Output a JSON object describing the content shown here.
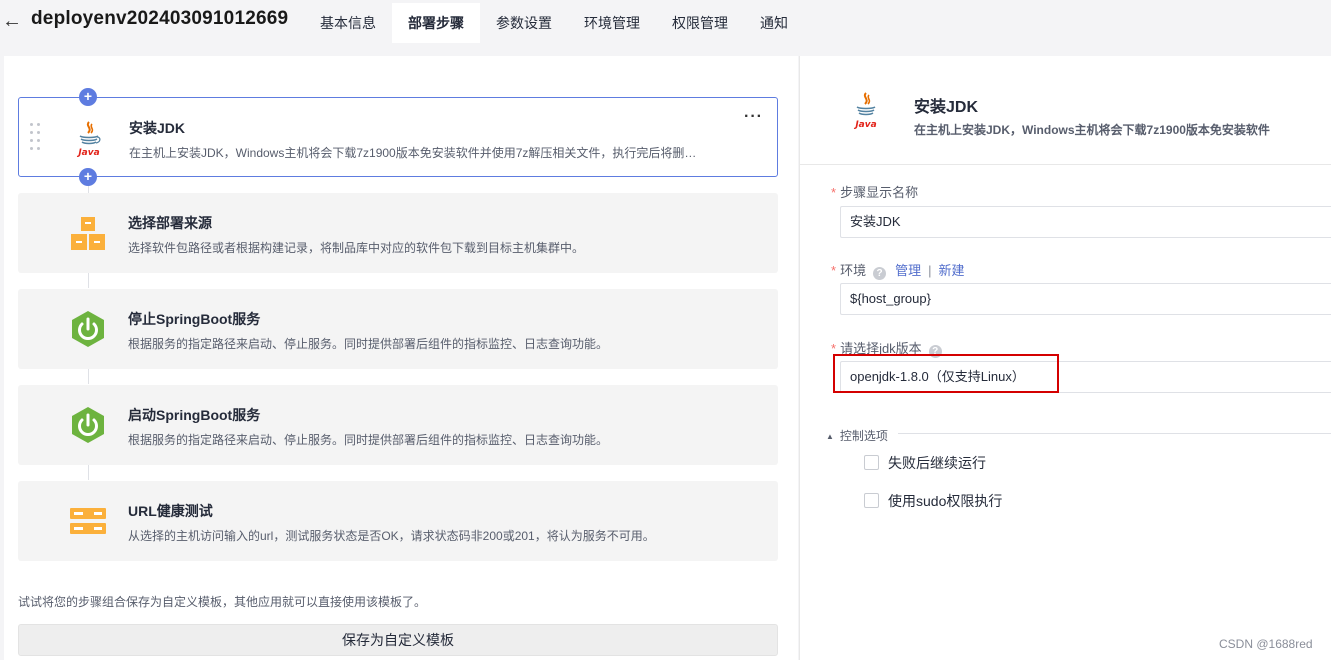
{
  "header": {
    "back_label": "←",
    "title": "deployenv202403091012669",
    "tabs": [
      {
        "label": "基本信息",
        "active": false
      },
      {
        "label": "部署步骤",
        "active": true
      },
      {
        "label": "参数设置",
        "active": false
      },
      {
        "label": "环境管理",
        "active": false
      },
      {
        "label": "权限管理",
        "active": false
      },
      {
        "label": "通知",
        "active": false
      }
    ]
  },
  "steps": [
    {
      "title": "安装JDK",
      "desc": "在主机上安装JDK，Windows主机将会下载7z1900版本免安装软件并使用7z解压相关文件，执行完后将删除相关安装包。",
      "icon": "java-icon",
      "selected": true
    },
    {
      "title": "选择部署来源",
      "desc": "选择软件包路径或者根据构建记录，将制品库中对应的软件包下载到目标主机集群中。",
      "icon": "package-source-icon",
      "selected": false
    },
    {
      "title": "停止SpringBoot服务",
      "desc": "根据服务的指定路径来启动、停止服务。同时提供部署后组件的指标监控、日志查询功能。",
      "icon": "springboot-icon",
      "selected": false
    },
    {
      "title": "启动SpringBoot服务",
      "desc": "根据服务的指定路径来启动、停止服务。同时提供部署后组件的指标监控、日志查询功能。",
      "icon": "springboot-icon",
      "selected": false
    },
    {
      "title": "URL健康测试",
      "desc": "从选择的主机访问输入的url，测试服务状态是否OK，请求状态码非200或201，将认为服务不可用。",
      "icon": "url-health-icon",
      "selected": false
    }
  ],
  "more_label": "···",
  "plus_label": "+",
  "template_tip": "试试将您的步骤组合保存为自定义模板，其他应用就可以直接使用该模板了。",
  "save_template_label": "保存为自定义模板",
  "detail": {
    "title": "安装JDK",
    "desc": "在主机上安装JDK，Windows主机将会下载7z1900版本免安装软件",
    "name_label": "步骤显示名称",
    "name_value": "安装JDK",
    "env_label": "环境",
    "env_manage": "管理",
    "env_sep": "|",
    "env_new": "新建",
    "env_value": "${host_group}",
    "jdk_label": "请选择jdk版本",
    "jdk_value": "openjdk-1.8.0（仅支持Linux）",
    "control_label": "控制选项",
    "option_continue": "失败后继续运行",
    "option_sudo": "使用sudo权限执行"
  },
  "required_mark": "*",
  "help_mark": "?",
  "watermark": "CSDN @1688red",
  "colors": {
    "accent": "#5e7ce0",
    "link": "#526ecc",
    "highlight": "#d40000",
    "required": "#f66f6a"
  }
}
